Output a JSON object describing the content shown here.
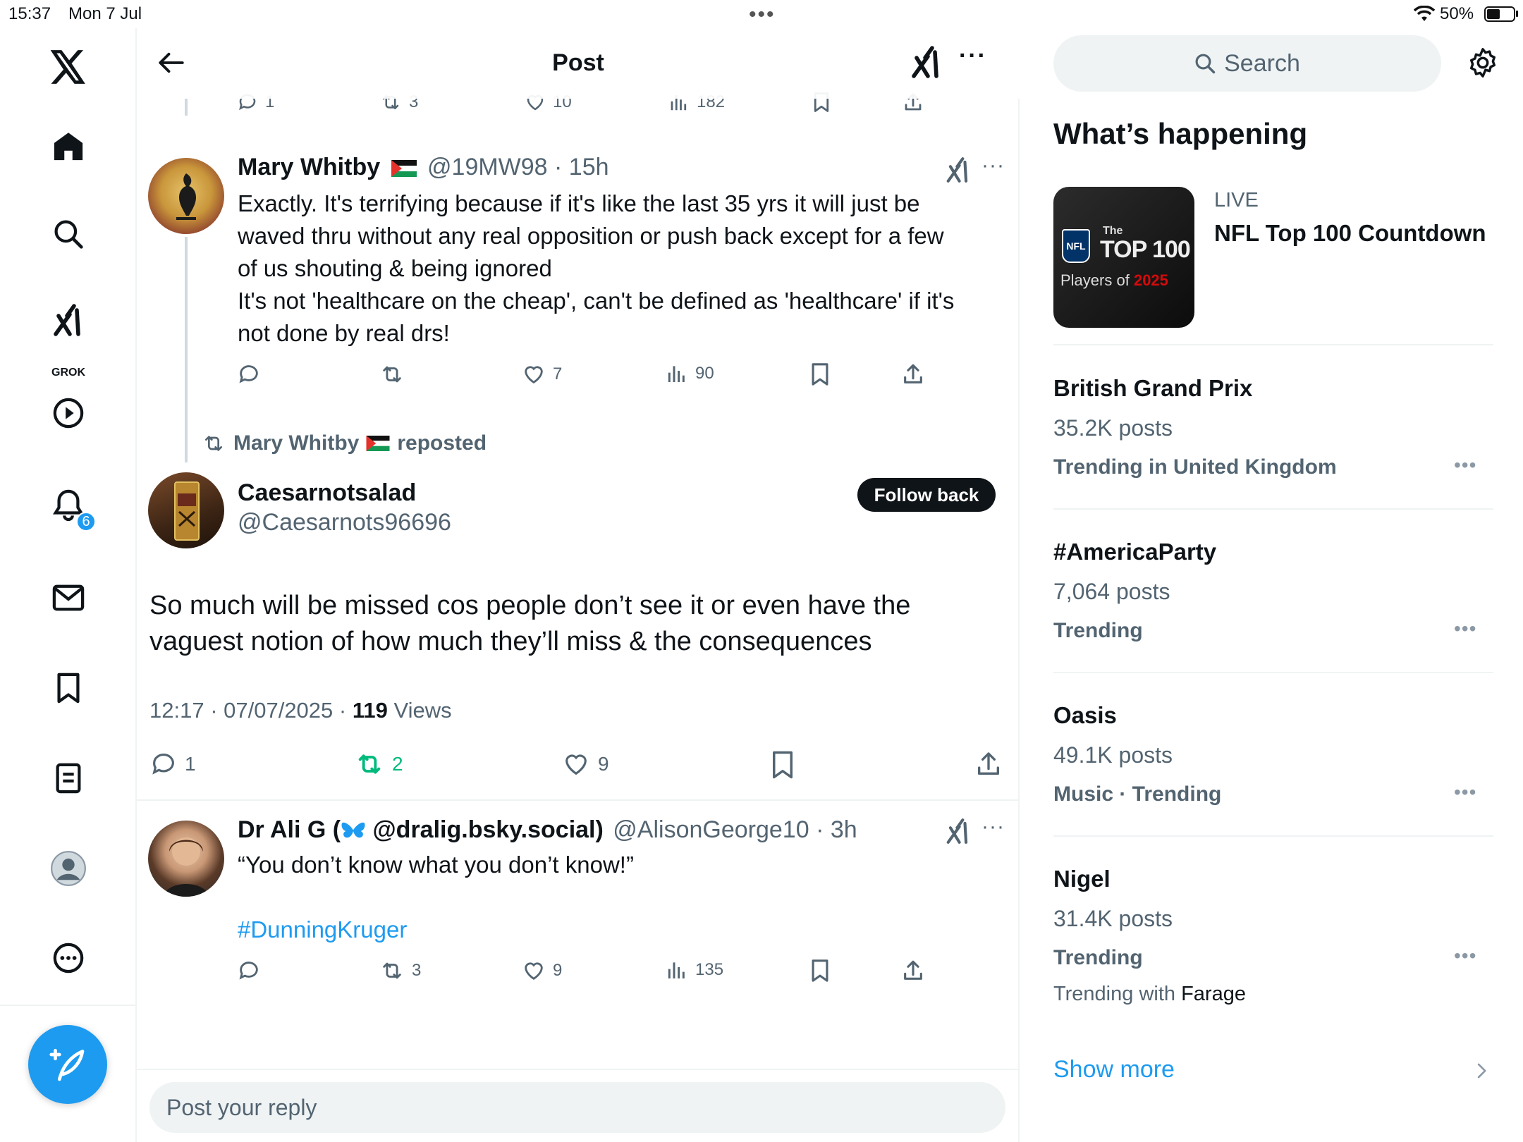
{
  "status_bar": {
    "time": "15:37",
    "date": "Mon 7 Jul",
    "battery": "50%"
  },
  "left_nav": {
    "grok_label": "GROK",
    "notifications_count": "6"
  },
  "header": {
    "title": "Post"
  },
  "prev_tweet_actions": {
    "replies": "1",
    "reposts": "3",
    "likes": "10",
    "views": "182"
  },
  "reply1": {
    "name": "Mary Whitby",
    "handle_time": "@19MW98 · 15h",
    "lines": [
      "Exactly. It's terrifying because if it's like the last 35 yrs it will just be",
      "waved thru without any real opposition or push back except for a few",
      "of us shouting & being ignored",
      "It's not 'healthcare on the cheap', can't be defined as 'healthcare' if it's",
      "not done by real drs!"
    ],
    "likes": "7",
    "views": "90"
  },
  "repost_banner": {
    "name": "Mary Whitby",
    "action": "reposted"
  },
  "main_post": {
    "name": "Caesarnotsalad",
    "handle": "@Caesarnots96696",
    "follow_label": "Follow back",
    "line1": "So much will be missed cos people don’t see it or even have the",
    "line2": "vaguest notion of how much they’ll miss & the consequences",
    "timestamp": "12:17 · 07/07/2025 · ",
    "views_count": "119",
    "views_label": " Views",
    "replies": "1",
    "reposts": "2",
    "likes": "9"
  },
  "reply2": {
    "name_prefix": "Dr Ali G (",
    "name_suffix": " @dralig.bsky.social)",
    "handle_time": "@AlisonGeorge10 · 3h",
    "text": "“You don’t know what you don’t know!”",
    "hashtag": "#DunningKruger",
    "reposts": "3",
    "likes": "9",
    "views": "135"
  },
  "reply_box": {
    "placeholder": "Post your reply"
  },
  "sidebar": {
    "search_label": "Search",
    "title": "What’s happening",
    "live": {
      "category": "LIVE",
      "name": "NFL Top 100 Countdown",
      "thumb_the": "The",
      "thumb_top": "TOP 100",
      "thumb_players": "Players of",
      "thumb_year": "2025",
      "thumb_logo": "NFL"
    },
    "trends": [
      {
        "name": "British Grand Prix",
        "posts": "35.2K posts",
        "context": "Trending in United Kingdom"
      },
      {
        "name": "#AmericaParty",
        "posts": "7,064 posts",
        "context": "Trending"
      },
      {
        "name": "Oasis",
        "posts": "49.1K posts",
        "context": "Music · Trending"
      },
      {
        "name": "Nigel",
        "posts": "31.4K posts",
        "context": "Trending",
        "with_prefix": "Trending with ",
        "with_name": "Farage"
      }
    ],
    "show_more": "Show more"
  },
  "colors": {
    "accent": "#1d9bf0",
    "repost_green": "#00ba7c",
    "text": "#0f1419",
    "muted": "#536471"
  }
}
